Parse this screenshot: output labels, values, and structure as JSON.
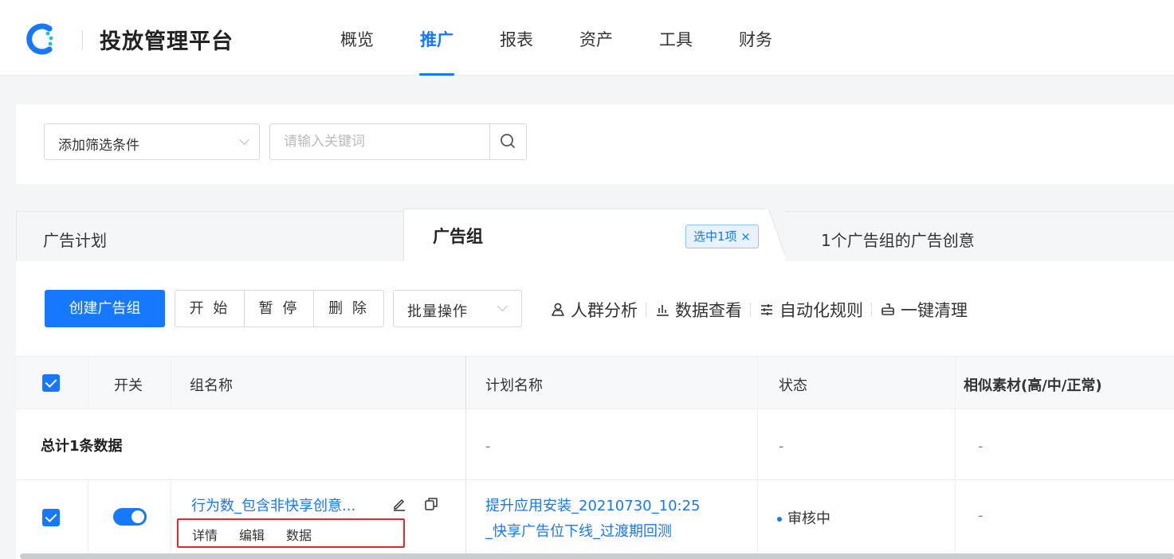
{
  "app": {
    "brand": "投放管理平台",
    "nav": [
      "概览",
      "推广",
      "报表",
      "资产",
      "工具",
      "财务"
    ],
    "active_nav": "推广"
  },
  "filter": {
    "select_label": "添加筛选条件",
    "search_placeholder": "请输入关键词"
  },
  "tabs": {
    "plan": "广告计划",
    "group": "广告组",
    "group_badge": "选中1项 ×",
    "creative": "1个广告组的广告创意"
  },
  "toolbar": {
    "create": "创建广告组",
    "start": "开 始",
    "pause": "暂 停",
    "delete": "删 除",
    "bulk": "批量操作",
    "audience": "人群分析",
    "data_view": "数据查看",
    "auto_rules": "自动化规则",
    "clean": "一键清理"
  },
  "table": {
    "headers": {
      "switch": "开关",
      "group_name": "组名称",
      "plan_name": "计划名称",
      "status": "状态",
      "similar": "相似素材(高/中/正常)"
    },
    "total_row": {
      "label": "总计1条数据",
      "plan_name": "-",
      "status": "-",
      "similar": "-"
    },
    "rows": [
      {
        "group_name": "行为数_包含非快享创意...",
        "actions": [
          "详情",
          "编辑",
          "数据"
        ],
        "plan_name_line1": "提升应用安装_20210730_10:25",
        "plan_name_line2": "_快享广告位下线_过渡期回测",
        "status": "审核中",
        "similar": "-"
      }
    ]
  },
  "colors": {
    "accent": "#1677ff",
    "highlight": "#e5262b"
  }
}
